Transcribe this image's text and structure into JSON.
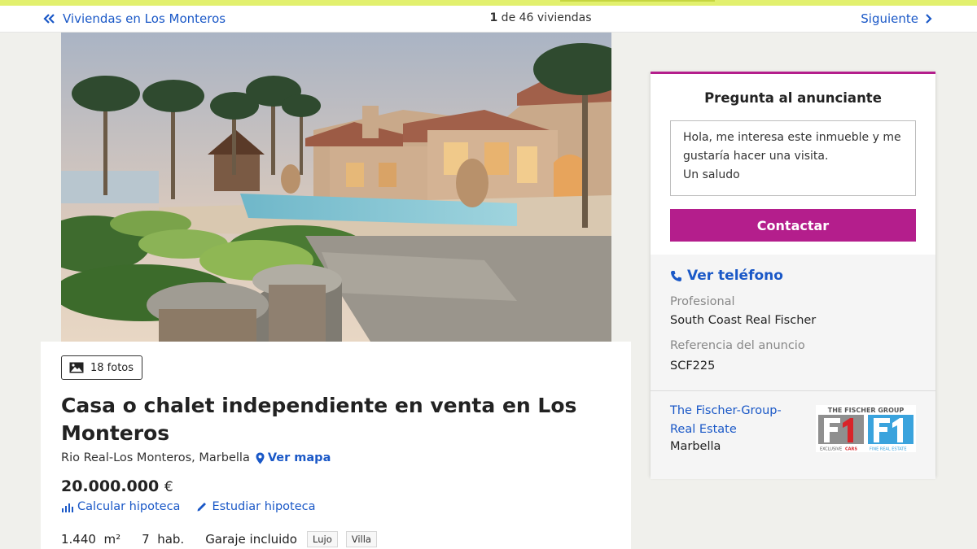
{
  "nav": {
    "back_label": "Viviendas en Los Monteros",
    "count_number": "1",
    "count_rest": " de 46 viviendas",
    "next_label": "Siguiente"
  },
  "listing": {
    "photos_label": "18 fotos",
    "title": "Casa o chalet independiente en venta en Los Monteros",
    "location": "Rio Real-Los Monteros, Marbella",
    "map_label": "Ver mapa",
    "price_value": "20.000.000",
    "price_currency": "€",
    "calc_label": "Calcular hipoteca",
    "study_label": "Estudiar hipoteca",
    "features": [
      "1.440  m²",
      "7  hab.",
      "Garaje incluido"
    ],
    "tags": [
      "Lujo",
      "Villa"
    ]
  },
  "contact": {
    "title": "Pregunta al anunciante",
    "message": "Hola, me interesa este inmueble y me gustaría hacer una visita.\nUn saludo",
    "button_label": "Contactar",
    "phone_label": "Ver teléfono",
    "professional_label": "Profesional",
    "professional_value": "South Coast Real Fischer",
    "reference_label": "Referencia del anuncio",
    "reference_value": "SCF225",
    "agency_line1": "The Fischer-Group-",
    "agency_line2": "Real Estate",
    "agency_city": "Marbella",
    "logo_top": "THE FISCHER GROUP",
    "logo_bottom_left": "EXCLUSIVE",
    "logo_bottom_mid": "CARS",
    "logo_bottom_right": "FINE REAL ESTATE"
  },
  "colors": {
    "link": "#1a58c7",
    "accent": "#b41e8c",
    "top_strip": "#e2f06e"
  }
}
